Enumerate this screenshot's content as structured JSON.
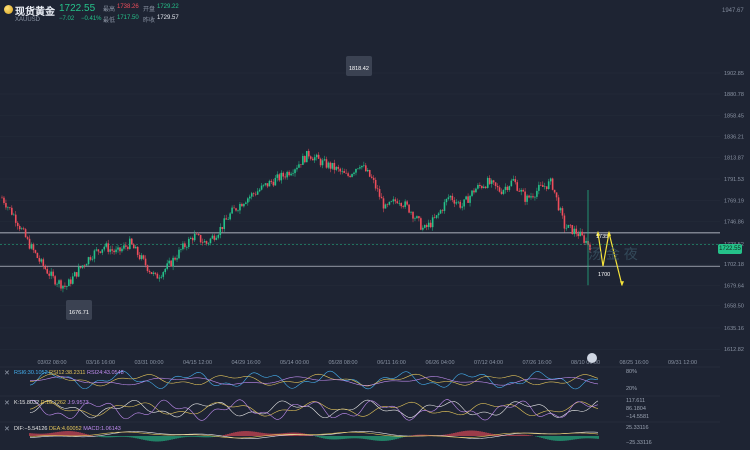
{
  "header": {
    "symbol": "现货黄金",
    "symbol_code": "XAUUSD",
    "dropdown_glyph": "▾",
    "price": "1722.55",
    "change": "−7.02",
    "change_pct": "−0.41%",
    "stats": [
      {
        "label": "最高",
        "value": "1738.26",
        "color": "#ef4d5b"
      },
      {
        "label": "开盘",
        "value": "1729.22",
        "color": "#25c28a"
      },
      {
        "label": "最低",
        "value": "1717.50",
        "color": "#25c28a"
      },
      {
        "label": "昨收",
        "value": "1729.57",
        "color": "#e9edf4"
      }
    ],
    "top_right_axis": "1947.67"
  },
  "price_axis": [
    "1902.85",
    "1880.78",
    "1858.45",
    "1836.21",
    "1813.87",
    "1791.53",
    "1769.19",
    "1746.86",
    "1723.52",
    "1702.18",
    "1679.64",
    "1658.50",
    "1635.16",
    "1612.82"
  ],
  "time_axis": [
    "03/02 08:00",
    "03/16 16:00",
    "03/31 00:00",
    "04/15 12:00",
    "04/29 16:00",
    "05/14 00:00",
    "05/28 08:00",
    "06/11 16:00",
    "06/26 04:00",
    "07/12 04:00",
    "07/26 16:00",
    "08/10 00:00",
    "08/25 16:00",
    "09/31 12:00"
  ],
  "annotations": {
    "high": "1818.42",
    "low": "1676.71",
    "mark_upper": "1735",
    "mark_lower": "1700",
    "current": "1722.55",
    "watermark": "汤 金 夜"
  },
  "indicators": [
    {
      "items": [
        {
          "t": "RSI6:30.1052",
          "c": "#45b0f0"
        },
        {
          "t": "RSI12:38.2311",
          "c": "#e3c45a"
        },
        {
          "t": "RSI24:43.0548",
          "c": "#c08cf0"
        }
      ],
      "axis": [
        "80%",
        "20%"
      ]
    },
    {
      "items": [
        {
          "t": "K:15.8032",
          "c": "#e8e8e8"
        },
        {
          "t": "D:18.7262",
          "c": "#e3c45a"
        },
        {
          "t": "J:9.9573",
          "c": "#c08cf0"
        }
      ],
      "axis": [
        "117.611",
        "86.1804",
        "−14.5581"
      ]
    },
    {
      "items": [
        {
          "t": "DIF:−5.54126",
          "c": "#e8e8e8"
        },
        {
          "t": "DEA:4.60052",
          "c": "#e3c45a"
        },
        {
          "t": "MACD:1.06143",
          "c": "#c08cf0"
        }
      ],
      "axis": [
        "25.33116",
        "−25.33116"
      ]
    }
  ],
  "chart_data": {
    "type": "candlestick",
    "title": "",
    "x_labels": [
      "03/02 08:00",
      "03/16 16:00",
      "03/31 00:00",
      "04/15 12:00",
      "04/29 16:00",
      "05/14 00:00",
      "05/28 08:00",
      "06/11 16:00",
      "06/26 04:00",
      "07/12 04:00",
      "07/26 16:00",
      "08/10 00:00"
    ],
    "path_close": [
      1772,
      1752,
      1726,
      1704,
      1687,
      1678,
      1696,
      1712,
      1721,
      1714,
      1724,
      1706,
      1688,
      1700,
      1717,
      1732,
      1724,
      1738,
      1757,
      1770,
      1779,
      1788,
      1795,
      1805,
      1818,
      1809,
      1803,
      1794,
      1808,
      1790,
      1760,
      1771,
      1758,
      1738,
      1751,
      1774,
      1763,
      1781,
      1788,
      1779,
      1790,
      1770,
      1781,
      1788,
      1742,
      1735,
      1722
    ],
    "ylim": [
      1612,
      1948
    ],
    "levels": {
      "upper": 1735,
      "lower": 1700
    },
    "forecast": [
      1735,
      1700,
      1735,
      1680
    ],
    "colors": {
      "up": "#25c28a",
      "down": "#ef4d5b"
    }
  }
}
